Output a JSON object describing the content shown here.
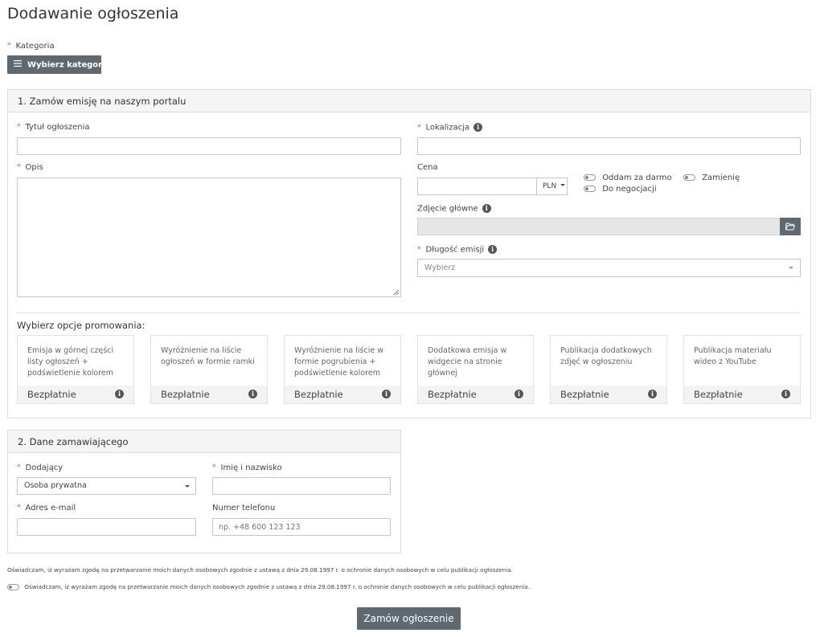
{
  "page": {
    "title": "Dodawanie ogłoszenia"
  },
  "category": {
    "label": "Kategoria",
    "button_label": "Wybierz kategorię",
    "required_mark": "*"
  },
  "section1": {
    "title": "1. Zamów emisję na naszym portalu",
    "title_label": "Tytuł ogłoszenia",
    "title_value": "",
    "location_label": "Lokalizacja",
    "location_value": "",
    "description_label": "Opis",
    "description_value": "",
    "price_label": "Cena",
    "price_value": "",
    "currency": "PLN",
    "free_label": "Oddam za darmo",
    "swap_label": "Zamienię",
    "negotiate_label": "Do negocjacji",
    "photo_label": "Zdjęcie główne",
    "duration_label": "Długość emisji",
    "duration_placeholder": "Wybierz",
    "promo_heading": "Wybierz opcje promowania:",
    "promo_options": [
      {
        "text": "Emisja w górnej części listy ogłoszeń + podświetlenie kolorem",
        "price": "Bezpłatnie"
      },
      {
        "text": "Wyróżnienie na liście ogłoszeń w formie ramki",
        "price": "Bezpłatnie"
      },
      {
        "text": "Wyróżnienie na liście w formie pogrubienia + podświetlenie kolorem",
        "price": "Bezpłatnie"
      },
      {
        "text": "Dodatkowa emisja w widgecie na stronie głównej",
        "price": "Bezpłatnie"
      },
      {
        "text": "Publikacja dodatkowych zdjęć w ogłoszeniu",
        "price": "Bezpłatnie"
      },
      {
        "text": "Publikacja materiału wideo z YouTube",
        "price": "Bezpłatnie"
      }
    ]
  },
  "section2": {
    "title": "2. Dane zamawiającego",
    "adder_label": "Dodający",
    "adder_value": "Osoba prywatna",
    "name_label": "Imię i nazwisko",
    "name_value": "",
    "email_label": "Adres e-mail",
    "email_value": "",
    "phone_label": "Numer telefonu",
    "phone_placeholder": "np. +48 600 123 123"
  },
  "consent": {
    "notice": "Oświadczam, iż wyrażam zgodę na przetwarzanie moich danych osobowych zgodnie z ustawą z dnia 29.08.1997 r. o ochronie danych osobowych w celu publikacji ogłoszenia.",
    "toggle_label": "Oświadczam, iż wyrażam zgodę na przetwarzanie moich danych osobowych zgodnie z ustawą z dnia 29.08.1997 r. o ochronie danych osobowych w celu publikacji ogłoszenia."
  },
  "submit": {
    "label": "Zamów ogłoszenie"
  },
  "icons": {
    "menu": "hamburger-icon",
    "info": "info-icon",
    "folder": "folder-open-icon",
    "resize": "resize-grip-icon"
  },
  "colors": {
    "required": "#d9534f",
    "button": "#5f6971",
    "panel_header": "#f5f5f5"
  }
}
